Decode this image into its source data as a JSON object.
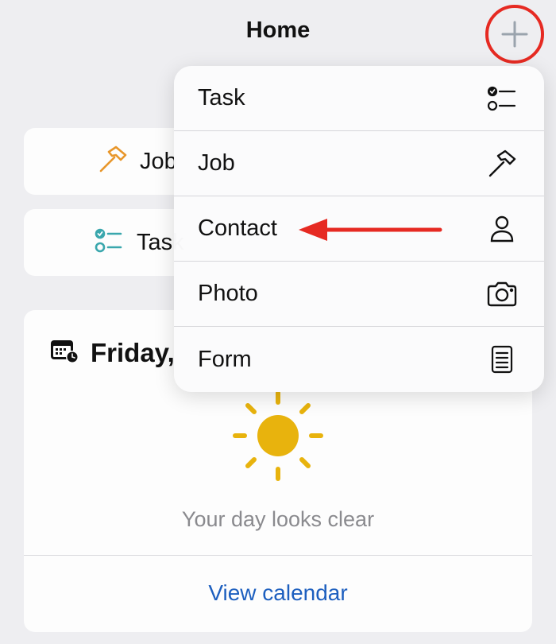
{
  "header": {
    "title": "Home",
    "add_icon": "plus-icon"
  },
  "quick_actions": [
    {
      "label": "Job",
      "icon": "hammer-icon",
      "color": "#e8962a"
    },
    {
      "label": "Task",
      "icon": "checklist-icon",
      "color": "#3aa7ad"
    }
  ],
  "day_card": {
    "title": "Friday,",
    "icon": "calendar-clock-icon",
    "empty_icon": "sun-icon",
    "empty_icon_color": "#e8b30d",
    "empty_message": "Your day looks clear",
    "view_calendar_label": "View calendar",
    "link_color": "#1d5fbf"
  },
  "menu": {
    "items": [
      {
        "label": "Task",
        "icon": "checklist-icon"
      },
      {
        "label": "Job",
        "icon": "hammer-icon"
      },
      {
        "label": "Contact",
        "icon": "person-icon"
      },
      {
        "label": "Photo",
        "icon": "camera-icon"
      },
      {
        "label": "Form",
        "icon": "form-icon"
      }
    ]
  },
  "annotation": {
    "highlight_color": "#e62a22"
  }
}
